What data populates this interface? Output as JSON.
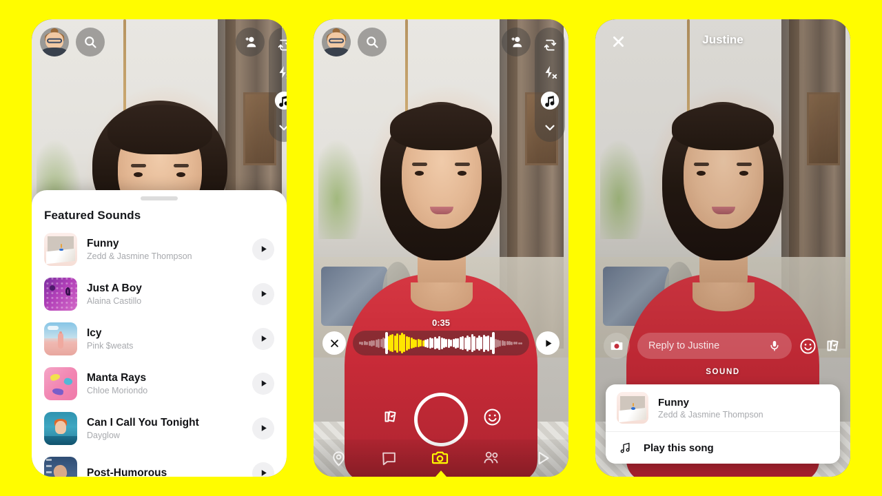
{
  "theme": {
    "brand_yellow": "#FFFC00",
    "accent_white": "#FFFFFF",
    "wave_active": "#FFE600",
    "text_dark": "#101114",
    "text_muted": "#A7A9AD"
  },
  "phone_left": {
    "name": "sounds-browser-screen",
    "top_bar": {
      "profile_icon": "bitmoji-avatar-icon",
      "search_icon": "search-icon",
      "add_friend_icon": "add-friend-icon"
    },
    "camera_rail": {
      "flip_icon": "flip-camera-icon",
      "flash_icon": "flash-off-icon",
      "music_icon": "music-note-icon",
      "more_icon": "chevron-down-icon"
    },
    "sheet": {
      "title": "Featured Sounds",
      "items": [
        {
          "title": "Funny",
          "artist": "Zedd & Jasmine Thompson",
          "art": "art-funny",
          "play_icon": "play-icon"
        },
        {
          "title": "Just A Boy",
          "artist": "Alaina Castillo",
          "art": "art-justaboy",
          "play_icon": "play-icon"
        },
        {
          "title": "Icy",
          "artist": "Pink $weats",
          "art": "art-icy",
          "play_icon": "play-icon"
        },
        {
          "title": "Manta Rays",
          "artist": "Chloe Moriondo",
          "art": "art-manta",
          "play_icon": "play-icon"
        },
        {
          "title": "Can I Call You Tonight",
          "artist": "Dayglow",
          "art": "art-dayglow",
          "play_icon": "play-icon"
        },
        {
          "title": "Post-Humorous",
          "artist": "",
          "art": "art-post",
          "play_icon": "play-icon"
        }
      ]
    }
  },
  "phone_mid": {
    "name": "sound-trim-camera-screen",
    "top_bar": {
      "profile_icon": "bitmoji-avatar-icon",
      "search_icon": "search-icon",
      "add_friend_icon": "add-friend-icon"
    },
    "camera_rail": {
      "flip_icon": "flip-camera-icon",
      "flash_icon": "flash-off-icon",
      "music_icon": "music-note-icon",
      "more_icon": "chevron-down-icon"
    },
    "trimmer": {
      "duration": "0:35",
      "close_icon": "close-icon",
      "play_icon": "play-icon",
      "waveform": {
        "bars": [
          4,
          5,
          6,
          5,
          7,
          9,
          8,
          11,
          13,
          12,
          16,
          15,
          20,
          24,
          26,
          22,
          28,
          24,
          30,
          26,
          21,
          18,
          16,
          13,
          11,
          12,
          10,
          9,
          11,
          13,
          16,
          14,
          18,
          15,
          20,
          17,
          14,
          12,
          13,
          10,
          12,
          15,
          14,
          18,
          20,
          17,
          23,
          19,
          26,
          21,
          17,
          22,
          18,
          25,
          20,
          23,
          19,
          16,
          13,
          11,
          9,
          8,
          7,
          6,
          6,
          5,
          4,
          4,
          3,
          3
        ],
        "active_start_index": 12,
        "active_end_index": 27,
        "trim_start_index": 11,
        "trim_end_index": 56
      }
    },
    "shutter": {
      "capture_icon": "shutter-button",
      "memories_icon": "memories-cards-icon",
      "lens_icon": "lens-smiley-icon"
    },
    "nav": [
      {
        "label": "Map",
        "icon": "map-pin-icon",
        "active": false
      },
      {
        "label": "Chat",
        "icon": "chat-bubble-icon",
        "active": false
      },
      {
        "label": "Camera",
        "icon": "camera-icon",
        "active": true
      },
      {
        "label": "Friends",
        "icon": "friends-icon",
        "active": false
      },
      {
        "label": "Spotlight",
        "icon": "play-triangle-icon",
        "active": false
      }
    ]
  },
  "phone_right": {
    "name": "snap-viewer-screen",
    "close_icon": "close-icon",
    "title": "Justine",
    "reply": {
      "camera_icon": "camera-circle-icon",
      "placeholder": "Reply to Justine",
      "mic_icon": "microphone-icon",
      "emoji_icon": "smiley-icon",
      "sticker_icon": "sticker-cards-icon"
    },
    "sound_section": {
      "label": "SOUND",
      "track": {
        "title": "Funny",
        "artist": "Zedd & Jasmine Thompson",
        "art": "art-funny"
      },
      "action": {
        "label": "Play this song",
        "icon": "music-note-icon"
      }
    }
  }
}
